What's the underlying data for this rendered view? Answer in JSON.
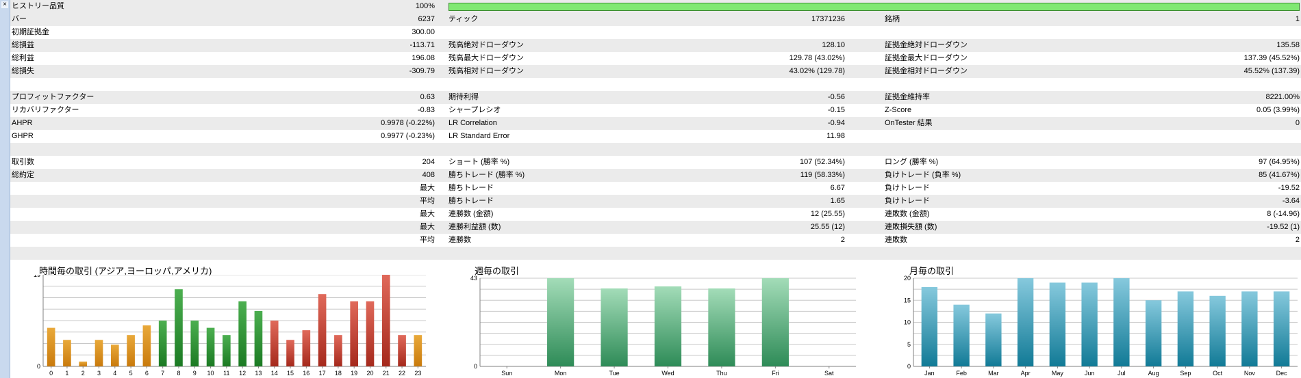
{
  "sidebar": {
    "close_glyph": "×"
  },
  "stats": {
    "rows": [
      {
        "shade": true,
        "l1": "ヒストリー品質",
        "v1": "100%",
        "l2": "",
        "v2": "",
        "l3": "",
        "v3": ""
      },
      {
        "shade": true,
        "l1": "バー",
        "v1": "6237",
        "l2": "ティック",
        "v2": "17371236",
        "l3": "銘柄",
        "v3": "1"
      },
      {
        "shade": false,
        "l1": "初期証拠金",
        "v1": "300.00",
        "l2": "",
        "v2": "",
        "l3": "",
        "v3": ""
      },
      {
        "shade": true,
        "l1": "総損益",
        "v1": "-113.71",
        "l2": "残高絶対ドローダウン",
        "v2": "128.10",
        "l3": "証拠金絶対ドローダウン",
        "v3": "135.58"
      },
      {
        "shade": false,
        "l1": "総利益",
        "v1": "196.08",
        "l2": "残高最大ドローダウン",
        "v2": "129.78 (43.02%)",
        "l3": "証拠金最大ドローダウン",
        "v3": "137.39 (45.52%)"
      },
      {
        "shade": true,
        "l1": "総損失",
        "v1": "-309.79",
        "l2": "残高相対ドローダウン",
        "v2": "43.02% (129.78)",
        "l3": "証拠金相対ドローダウン",
        "v3": "45.52% (137.39)"
      },
      {
        "shade": false,
        "l1": "",
        "v1": "",
        "l2": "",
        "v2": "",
        "l3": "",
        "v3": ""
      },
      {
        "shade": true,
        "l1": "プロフィットファクター",
        "v1": "0.63",
        "l2": "期待利得",
        "v2": "-0.56",
        "l3": "証拠金維持率",
        "v3": "8221.00%"
      },
      {
        "shade": false,
        "l1": "リカバリファクター",
        "v1": "-0.83",
        "l2": "シャープレシオ",
        "v2": "-0.15",
        "l3": "Z-Score",
        "v3": "0.05 (3.99%)"
      },
      {
        "shade": true,
        "l1": "AHPR",
        "v1": "0.9978 (-0.22%)",
        "l2": "LR Correlation",
        "v2": "-0.94",
        "l3": "OnTester 結果",
        "v3": "0"
      },
      {
        "shade": false,
        "l1": "GHPR",
        "v1": "0.9977 (-0.23%)",
        "l2": "LR Standard Error",
        "v2": "11.98",
        "l3": "",
        "v3": ""
      },
      {
        "shade": true,
        "l1": "",
        "v1": "",
        "l2": "",
        "v2": "",
        "l3": "",
        "v3": ""
      },
      {
        "shade": false,
        "l1": "取引数",
        "v1": "204",
        "l2": "ショート (勝率 %)",
        "v2": "107 (52.34%)",
        "l3": "ロング (勝率 %)",
        "v3": "97 (64.95%)"
      },
      {
        "shade": true,
        "l1": "総約定",
        "v1": "408",
        "l2": "勝ちトレード (勝率 %)",
        "v2": "119 (58.33%)",
        "l3": "負けトレード (負率 %)",
        "v3": "85 (41.67%)"
      },
      {
        "shade": false,
        "l1": "",
        "v1": "最大",
        "l2": "勝ちトレード",
        "v2": "6.67",
        "l3": "負けトレード",
        "v3": "-19.52"
      },
      {
        "shade": true,
        "l1": "",
        "v1": "平均",
        "l2": "勝ちトレード",
        "v2": "1.65",
        "l3": "負けトレード",
        "v3": "-3.64"
      },
      {
        "shade": false,
        "l1": "",
        "v1": "最大",
        "l2": "連勝数 (金額)",
        "v2": "12 (25.55)",
        "l3": "連敗数 (金額)",
        "v3": "8 (-14.96)"
      },
      {
        "shade": true,
        "l1": "",
        "v1": "最大",
        "l2": "連勝利益額 (数)",
        "v2": "25.55 (12)",
        "l3": "連敗損失額 (数)",
        "v3": "-19.52 (1)"
      },
      {
        "shade": false,
        "l1": "",
        "v1": "平均",
        "l2": "連勝数",
        "v2": "2",
        "l3": "連敗数",
        "v3": "2"
      },
      {
        "shade": true,
        "l1": "",
        "v1": "",
        "l2": "",
        "v2": "",
        "l3": "",
        "v3": ""
      }
    ],
    "history_quality_fraction": 1.0,
    "history_quality_color": "#80e872"
  },
  "chart_data": [
    {
      "type": "bar",
      "title": "時間毎の取引 (アジア,ヨーロッパ,アメリカ)",
      "categories": [
        "0",
        "1",
        "2",
        "3",
        "4",
        "5",
        "6",
        "7",
        "8",
        "9",
        "10",
        "11",
        "12",
        "13",
        "14",
        "15",
        "16",
        "17",
        "18",
        "19",
        "20",
        "21",
        "22",
        "23"
      ],
      "values": [
        8,
        5.5,
        1,
        5.5,
        4.5,
        6.5,
        8.5,
        9.5,
        16,
        9.5,
        8,
        6.5,
        13.5,
        11.5,
        9.5,
        5.5,
        7.5,
        15,
        6.5,
        13.5,
        13.5,
        20,
        6.5,
        6.5
      ],
      "colors": [
        "orange",
        "orange",
        "orange",
        "orange",
        "orange",
        "orange",
        "orange",
        "green",
        "green",
        "green",
        "green",
        "green",
        "green",
        "green",
        "red",
        "red",
        "red",
        "red",
        "red",
        "red",
        "red",
        "red",
        "red",
        "orange"
      ],
      "ylim": [
        0,
        19
      ],
      "yticks": [
        "0",
        "19"
      ],
      "grid": true
    },
    {
      "type": "bar",
      "title": "週毎の取引",
      "categories": [
        "Sun",
        "Mon",
        "Tue",
        "Wed",
        "Thu",
        "Fri",
        "Sat"
      ],
      "values": [
        0,
        43,
        38,
        39,
        38,
        43,
        0
      ],
      "ylim": [
        0,
        43
      ],
      "yticks": [
        "0",
        "43"
      ],
      "grid": true
    },
    {
      "type": "bar",
      "title": "月毎の取引",
      "categories": [
        "Jan",
        "Feb",
        "Mar",
        "Apr",
        "May",
        "Jun",
        "Jul",
        "Aug",
        "Sep",
        "Oct",
        "Nov",
        "Dec"
      ],
      "values": [
        18,
        14,
        12,
        20,
        19,
        19,
        20,
        15,
        17,
        16,
        17,
        17
      ],
      "ylim": [
        0,
        20
      ],
      "yticks": [
        "0",
        "5",
        "10",
        "15",
        "20"
      ],
      "grid": true
    }
  ]
}
